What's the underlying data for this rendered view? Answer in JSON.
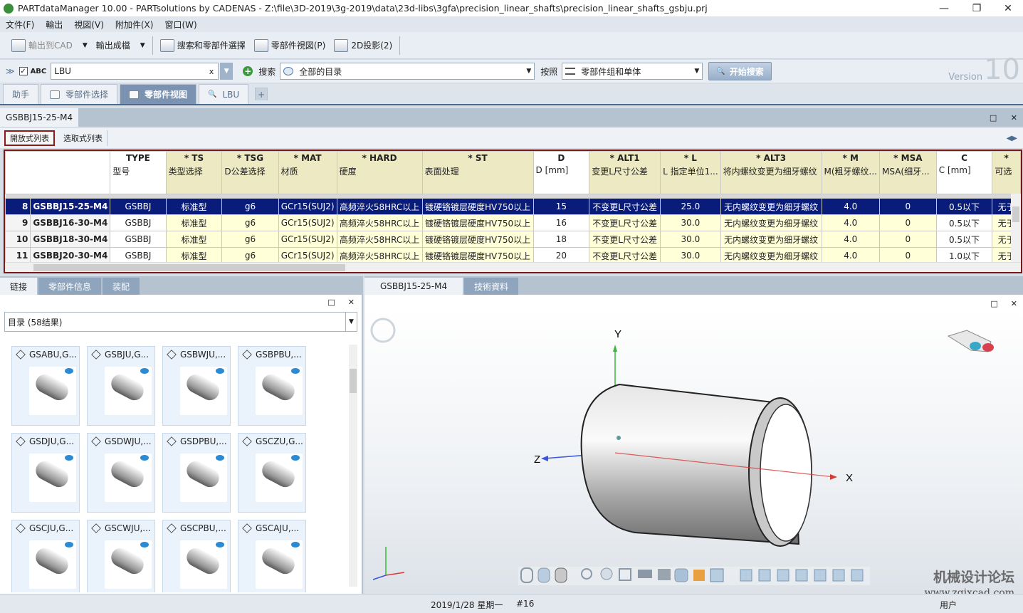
{
  "window": {
    "title": "PARTdataManager 10.00 - PARTsolutions by CADENAS - Z:\\file\\3D-2019\\3g-2019\\data\\23d-libs\\3gfa\\precision_linear_shafts\\precision_linear_shafts_gsbju.prj"
  },
  "menu": [
    "文件(F)",
    "輸出",
    "視図(V)",
    "附加件(X)",
    "窗口(W)"
  ],
  "toolbar": {
    "export_cad": "輸出到CAD",
    "export_file": "輸出成檔",
    "search_select": "搜索和零部件選擇",
    "part_view": "零部件視図(P)",
    "proj2d": "2D投影(2)"
  },
  "search": {
    "abc_label": "ABC",
    "query": "LBU",
    "clear": "x",
    "search_label": "搜索",
    "catalog": "全部的目录",
    "by_label": "按照",
    "mode": "零部件组和单体",
    "button": "开始搜索"
  },
  "version": {
    "label": "Version",
    "number": "10"
  },
  "tabs": [
    "助手",
    "零部件选择",
    "零部件视图",
    "LBU"
  ],
  "panel": {
    "title": "GSBBJ15-25-M4"
  },
  "subtabs": [
    "開放式列表",
    "选取式列表"
  ],
  "table": {
    "columns": [
      {
        "code": "",
        "desc": ""
      },
      {
        "code": "TYPE",
        "desc": "型号"
      },
      {
        "code": "* TS",
        "desc": "类型选择"
      },
      {
        "code": "* TSG",
        "desc": "D公差选择"
      },
      {
        "code": "* MAT",
        "desc": "材质"
      },
      {
        "code": "* HARD",
        "desc": "硬度"
      },
      {
        "code": "* ST",
        "desc": "表面处理"
      },
      {
        "code": "D",
        "desc": "D [mm]"
      },
      {
        "code": "* ALT1",
        "desc": "变更L尺寸公差"
      },
      {
        "code": "* L",
        "desc": "L 指定单位1..."
      },
      {
        "code": "* ALT3",
        "desc": "将内螺纹变更为细牙螺纹"
      },
      {
        "code": "* M",
        "desc": "M(粗牙螺纹..."
      },
      {
        "code": "* MSA",
        "desc": "MSA(细牙..."
      },
      {
        "code": "C",
        "desc": "C [mm]"
      },
      {
        "code": "* ",
        "desc": "可选"
      }
    ],
    "rows": [
      {
        "n": "8",
        "name": "GSBBJ15-25-M4",
        "type": "GSBBJ",
        "ts": "标准型",
        "tsg": "g6",
        "mat": "GCr15(SUJ2)",
        "hard": "高频淬火58HRC以上",
        "st": "镀硬铬镀层硬度HV750以上",
        "d": "15",
        "alt1": "不变更L尺寸公差",
        "l": "25.0",
        "alt3": "无内螺纹变更为细牙螺纹",
        "m": "4.0",
        "msa": "0",
        "c": "0.5以下",
        "x": "无于"
      },
      {
        "n": "9",
        "name": "GSBBJ16-30-M4",
        "type": "GSBBJ",
        "ts": "标准型",
        "tsg": "g6",
        "mat": "GCr15(SUJ2)",
        "hard": "高频淬火58HRC以上",
        "st": "镀硬铬镀层硬度HV750以上",
        "d": "16",
        "alt1": "不变更L尺寸公差",
        "l": "30.0",
        "alt3": "无内螺纹变更为细牙螺纹",
        "m": "4.0",
        "msa": "0",
        "c": "0.5以下",
        "x": "无于"
      },
      {
        "n": "10",
        "name": "GSBBJ18-30-M4",
        "type": "GSBBJ",
        "ts": "标准型",
        "tsg": "g6",
        "mat": "GCr15(SUJ2)",
        "hard": "高频淬火58HRC以上",
        "st": "镀硬铬镀层硬度HV750以上",
        "d": "18",
        "alt1": "不变更L尺寸公差",
        "l": "30.0",
        "alt3": "无内螺纹变更为细牙螺纹",
        "m": "4.0",
        "msa": "0",
        "c": "0.5以下",
        "x": "无于"
      },
      {
        "n": "11",
        "name": "GSBBJ20-30-M4",
        "type": "GSBBJ",
        "ts": "标准型",
        "tsg": "g6",
        "mat": "GCr15(SUJ2)",
        "hard": "高频淬火58HRC以上",
        "st": "镀硬铬镀层硬度HV750以上",
        "d": "20",
        "alt1": "不变更L尺寸公差",
        "l": "30.0",
        "alt3": "无内螺纹变更为细牙螺纹",
        "m": "4.0",
        "msa": "0",
        "c": "1.0以下",
        "x": "无于"
      }
    ]
  },
  "left": {
    "tabs": [
      "链接",
      "零部件信息",
      "装配"
    ],
    "dropdown": "目录 (58结果)",
    "items": [
      "GSABU,G...",
      "GSBJU,G...",
      "GSBWJU,...",
      "GSBPBU,...",
      "GSDJU,G...",
      "GSDWJU,...",
      "GSDPBU,...",
      "GSCZU,G...",
      "GSCJU,G...",
      "GSCWJU,...",
      "GSCPBU,...",
      "GSCAJU,..."
    ]
  },
  "right": {
    "tabs": [
      "GSBBJ15-25-M4",
      "技術資料"
    ],
    "axes": {
      "x": "X",
      "y": "Y",
      "z": "Z"
    }
  },
  "status": {
    "date": "2019/1/28 星期一",
    "id": "#16",
    "user": "用户"
  },
  "watermark": {
    "title": "机械设计论坛",
    "url": "www.zgjxcad.com"
  },
  "colors": {
    "accent": "#7b93b0",
    "selected_row": "#0a1c7a",
    "highlight_border": "#7a1717",
    "param_header": "#ede9c2",
    "param_cell": "#ffffd8"
  }
}
